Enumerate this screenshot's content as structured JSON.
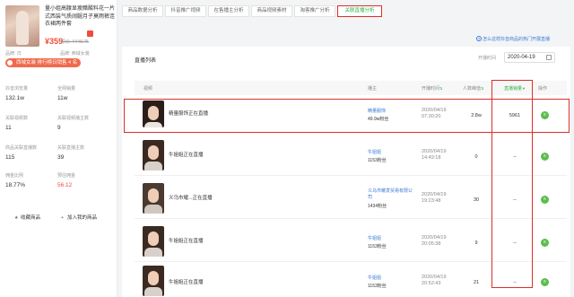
{
  "product": {
    "title": "量小姐高腰显瘦醋酸料花一片式西装气质阔腿月子莫雨裤连衣裙两件套",
    "price": "¥359",
    "old_price": "原价: ¥448.75",
    "subnote_left": "品牌: 日",
    "subnote_right": "品牌: 西域女装",
    "rank_badge": "西域女装 排行榜日销售 4 名",
    "stats": [
      {
        "label": "抖音浏览量",
        "value": "132.1w"
      },
      {
        "label": "全网销量",
        "value": "11w"
      },
      {
        "label": "关联视频数",
        "value": "11"
      },
      {
        "label": "关联视频播主数",
        "value": "9"
      },
      {
        "label": "商品关联直播数",
        "value": "115"
      },
      {
        "label": "关联直播主数",
        "value": "39"
      },
      {
        "label": "佣金比例",
        "value": "18.77%"
      },
      {
        "label": "预估佣金",
        "value": "56.12"
      }
    ],
    "actions": [
      {
        "icon": "star-icon",
        "label": "收藏商品"
      },
      {
        "icon": "plus-icon",
        "label": "加入我的商品"
      }
    ]
  },
  "tabs": [
    "商品数据分析",
    "抖音推广视频",
    "在售播主分析",
    "商品视频素材",
    "淘客推广分析",
    "关联直播分析"
  ],
  "active_tab": 5,
  "help_link": "怎么这样抖音商品的热门开展直播",
  "card": {
    "title": "直播列表",
    "date_label": "开播时间",
    "date_value": "2020-04-19"
  },
  "table": {
    "headers": [
      "视频",
      "播主",
      "开播时间",
      "人数峰值",
      "直播销量",
      "操作"
    ],
    "rows": [
      {
        "live_title": "精量服饰正在直播",
        "anchor": "精量服饰",
        "fans": "49.9w粉丝",
        "date": "2020/04/19",
        "time": "07:30:20",
        "viewers": "2.8w",
        "sales": "5961"
      },
      {
        "live_title": "牛姐姐正在直播",
        "anchor": "牛姐姐",
        "fans": "1153粉丝",
        "date": "2020/04/19",
        "time": "14:49:18",
        "viewers": "0",
        "sales": "--"
      },
      {
        "live_title": "义乌市耀...正在直播",
        "anchor": "义乌市耀发贸易有限公司",
        "fans": "1434粉丝",
        "date": "2020/04/19",
        "time": "19:23:48",
        "viewers": "30",
        "sales": "--"
      },
      {
        "live_title": "牛姐姐正在直播",
        "anchor": "牛姐姐",
        "fans": "1153粉丝",
        "date": "2020/04/19",
        "time": "20:05:38",
        "viewers": "9",
        "sales": "--"
      },
      {
        "live_title": "牛姐姐正在直播",
        "anchor": "牛姐姐",
        "fans": "1153粉丝",
        "date": "2020/04/19",
        "time": "20:52:43",
        "viewers": "21",
        "sales": "--"
      }
    ]
  },
  "colors": {
    "accent": "#34b14a",
    "highlight": "#d9302a",
    "link": "#3a7bd5",
    "price": "#f14c3a"
  }
}
